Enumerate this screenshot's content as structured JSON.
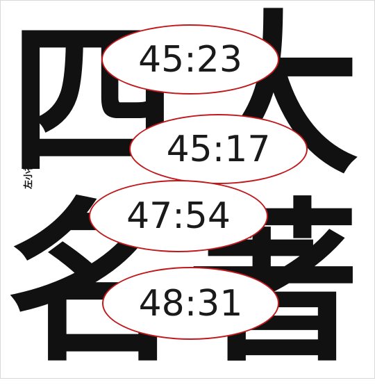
{
  "artwork": {
    "characters": [
      "四",
      "大",
      "名",
      "著"
    ],
    "side_text": "左小祖咒"
  },
  "time_labels": [
    "45:23",
    "45:17",
    "47:54",
    "48:31"
  ],
  "colors": {
    "oval_border": "#c0191c",
    "oval_fill": "#ffffff",
    "glyph": "#111111",
    "background": "#ffffff"
  }
}
